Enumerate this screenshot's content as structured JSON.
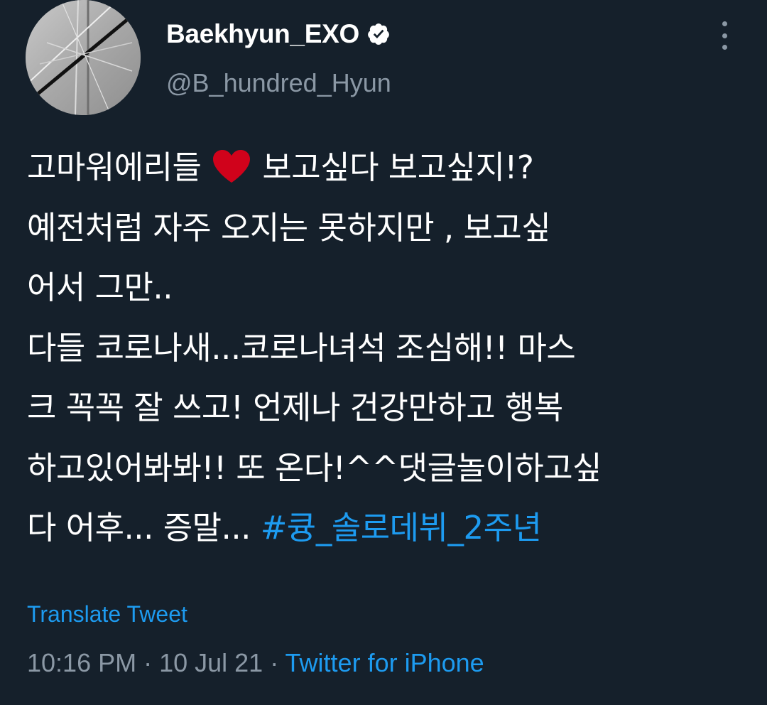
{
  "author": {
    "display_name": "Baekhyun_EXO",
    "handle": "@B_hundred_Hyun",
    "avatar_icon": "profile-avatar",
    "verified_icon": "verified-badge-icon"
  },
  "menu_icon": "more-options-icon",
  "tweet": {
    "line1_a": "고마워에리들",
    "heart_icon": "red-heart-emoji",
    "line1_b": "보고싶다 보고싶지!?",
    "line2": "예전처럼 자주 오지는 못하지만 , 보고싶",
    "line3": "어서 그만..",
    "line4": "다들 코로나새...코로나녀석 조심해!! 마스",
    "line5": "크 꼭꼭 잘 쓰고! 언제나 건강만하고 행복",
    "line6": "하고있어봐봐!! 또 온다!^^댓글놀이하고싶",
    "line7_a": "다 어후... 증말...",
    "hashtag": "#큥_솔로데뷔_2주년"
  },
  "translate_label": "Translate Tweet",
  "meta": {
    "time": "10:16 PM",
    "separator": " · ",
    "date": "10 Jul 21",
    "source": "Twitter for iPhone"
  },
  "colors": {
    "background": "#15202b",
    "text": "#ffffff",
    "secondary": "#8b98a5",
    "link": "#1d9bf0",
    "heart": "#d0021b"
  }
}
